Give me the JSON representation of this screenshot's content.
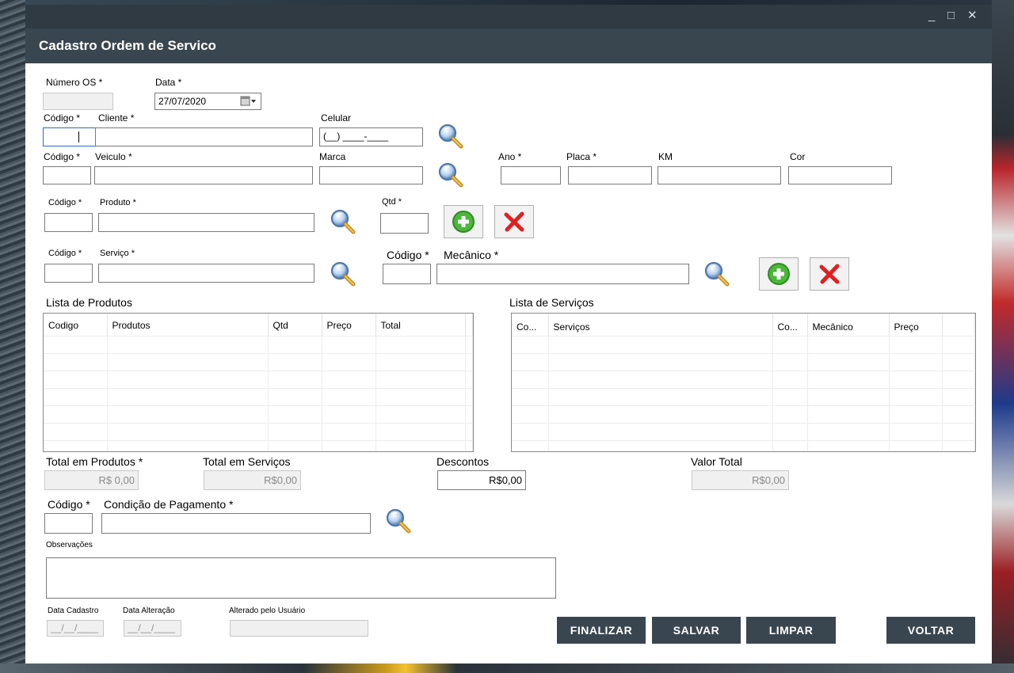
{
  "window": {
    "title": "Cadastro Ordem de Servico"
  },
  "os": {
    "numero_label": "Número OS *",
    "numero_value": "",
    "data_label": "Data *",
    "data_value": "27/07/2020"
  },
  "cliente": {
    "codigo_label": "Código *",
    "cliente_label": "Cliente *",
    "celular_label": "Celular",
    "celular_value": "(__) ____-____"
  },
  "veiculo": {
    "codigo_label": "Código *",
    "veiculo_label": "Veiculo *",
    "marca_label": "Marca",
    "ano_label": "Ano *",
    "placa_label": "Placa *",
    "km_label": "KM",
    "cor_label": "Cor"
  },
  "produto": {
    "codigo_label": "Código *",
    "produto_label": "Produto *",
    "qtd_label": "Qtd *"
  },
  "servico": {
    "codigo_label": "Código *",
    "servico_label": "Serviço *",
    "mec_codigo_label": "Código *",
    "mecanico_label": "Mecânico *"
  },
  "lista_produtos": {
    "title": "Lista de Produtos",
    "columns": [
      "Codigo",
      "Produtos",
      "Qtd",
      "Preço",
      "Total"
    ]
  },
  "lista_servicos": {
    "title": "Lista de Serviços",
    "columns": [
      "Co...",
      "Serviços",
      "Co...",
      "Mecânico",
      "Preço"
    ]
  },
  "totais": {
    "produtos_label": "Total em Produtos *",
    "produtos_value": "R$ 0,00",
    "servicos_label": "Total em Serviços",
    "servicos_value": "R$0,00",
    "descontos_label": "Descontos",
    "descontos_value": "R$0,00",
    "valor_label": "Valor Total",
    "valor_value": "R$0,00"
  },
  "pagamento": {
    "codigo_label": "Código *",
    "condicao_label": "Condição de Pagamento *"
  },
  "observacoes": {
    "label": "Observações"
  },
  "meta": {
    "cadastro_label": "Data Cadastro",
    "cadastro_value": "__/__/____",
    "alteracao_label": "Data Alteração",
    "alteracao_value": "__/__/____",
    "usuario_label": "Alterado pelo Usuário"
  },
  "buttons": {
    "finalizar": "FINALIZAR",
    "salvar": "SALVAR",
    "limpar": "LIMPAR",
    "voltar": "VOLTAR"
  },
  "icons": {
    "search": "magnifier-icon",
    "add": "add-icon",
    "remove": "remove-icon"
  },
  "colors": {
    "header": "#3a464f",
    "titlebar": "#2f3a43",
    "add_green": "#4cb73a",
    "remove_red": "#e02020"
  }
}
